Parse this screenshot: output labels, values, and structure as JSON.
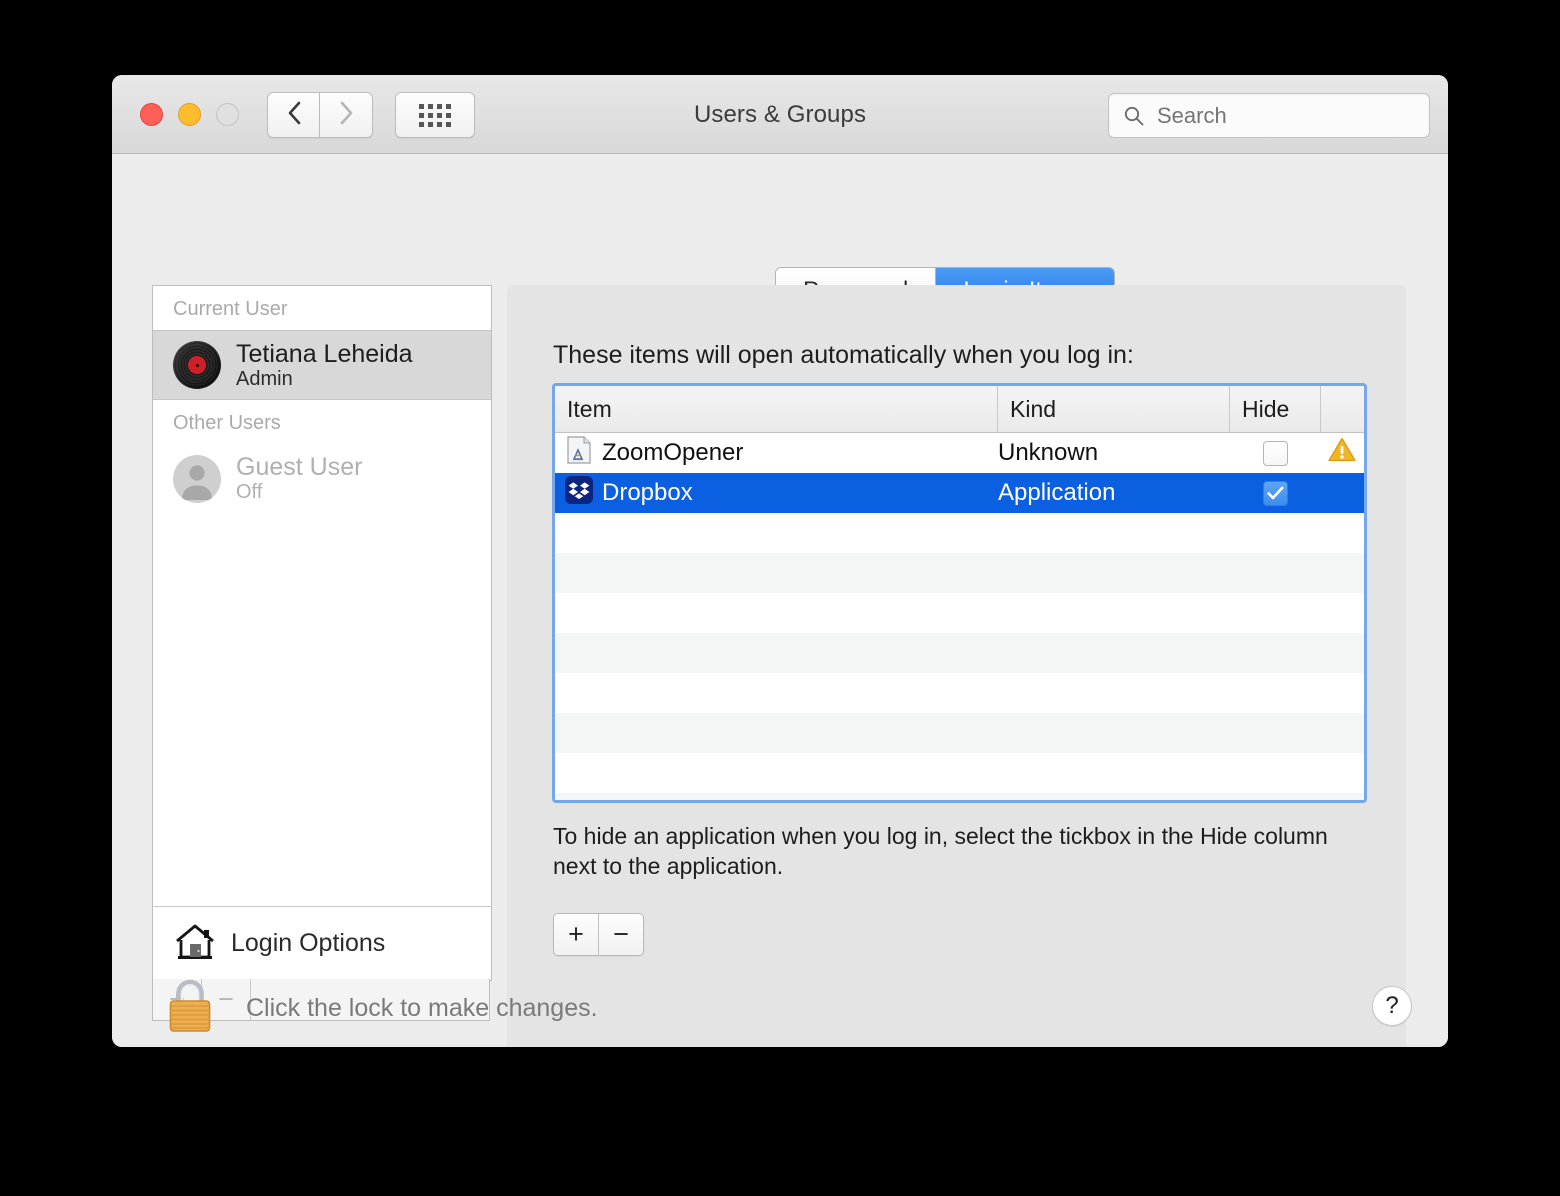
{
  "window": {
    "title": "Users & Groups",
    "traffic_lights": [
      "close",
      "minimize",
      "zoom"
    ]
  },
  "toolbar": {
    "back_icon": "chevron-left-icon",
    "forward_icon": "chevron-right-icon",
    "grid_icon": "show-all-grid-icon",
    "search": {
      "placeholder": "Search",
      "value": "",
      "icon": "search-icon"
    }
  },
  "sidebar": {
    "groups": [
      {
        "label": "Current User",
        "users": [
          {
            "name": "Tetiana Leheida",
            "role": "Admin",
            "avatar": "vinyl-record-avatar",
            "selected": true,
            "enabled": true
          }
        ]
      },
      {
        "label": "Other Users",
        "users": [
          {
            "name": "Guest User",
            "role": "Off",
            "avatar": "person-silhouette-avatar",
            "selected": false,
            "enabled": false
          }
        ]
      }
    ],
    "login_options": {
      "label": "Login Options",
      "icon": "house-icon"
    },
    "footer": {
      "add_label": "+",
      "remove_label": "−",
      "enabled": false
    }
  },
  "tabs": [
    {
      "label": "Password",
      "active": false
    },
    {
      "label": "Login Items",
      "active": true
    }
  ],
  "panel": {
    "caption": "These items will open automatically when you log in:",
    "hint": "To hide an application when you log in, select the tickbox in the Hide column next to the application.",
    "add_label": "+",
    "remove_label": "−"
  },
  "table": {
    "columns": [
      "Item",
      "Kind",
      "Hide"
    ],
    "rows": [
      {
        "item": "ZoomOpener",
        "kind": "Unknown",
        "hide_checked": false,
        "icon": "generic-document-app-icon",
        "warning": true,
        "warning_icon": "warning-triangle-icon",
        "selected": false
      },
      {
        "item": "Dropbox",
        "kind": "Application",
        "hide_checked": true,
        "icon": "dropbox-icon",
        "warning": false,
        "selected": true
      }
    ],
    "empty_rows": 7
  },
  "footer": {
    "lock_text": "Click the lock to make changes.",
    "lock_icon": "locked-padlock-icon",
    "help_label": "?",
    "help_icon": "help-question-icon"
  },
  "colors": {
    "accent_blue": "#0a60e0",
    "tab_active_blue": "#1b72e8",
    "focus_ring": "#75a8e8",
    "warning_yellow": "#f2b524",
    "dropbox_blue": "#0d2481",
    "window_chrome": "#ececec"
  }
}
